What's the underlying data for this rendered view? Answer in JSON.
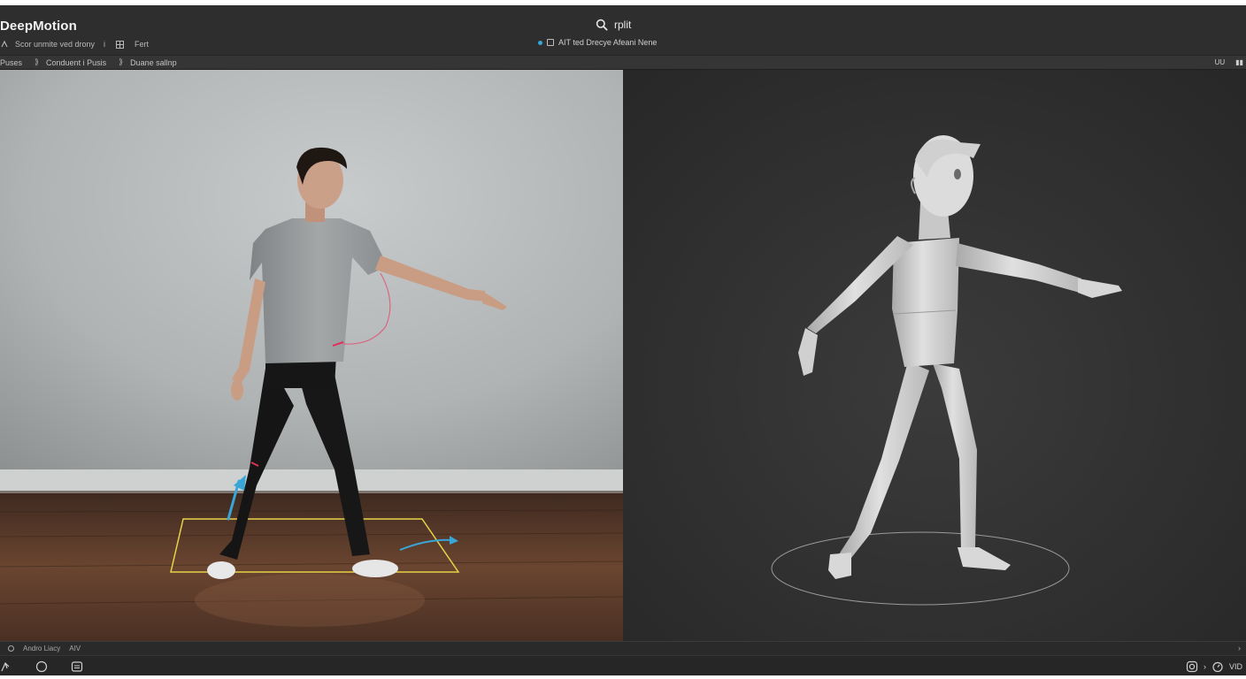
{
  "app": {
    "title": "DeepMotion"
  },
  "search": {
    "text": "rplit",
    "icon": "search-icon"
  },
  "menu": {
    "items": [
      "Scor  unmite ved drony",
      "Fert"
    ],
    "separator": "i"
  },
  "status": {
    "text": "AIT  ted Drecye Afeani Nene"
  },
  "breadcrumb": {
    "items": [
      "Puses",
      "Conduent i Pusis",
      "Duane sallnp"
    ]
  },
  "subbar_right": {
    "labels": [
      "UU",
      "▮▮"
    ]
  },
  "timeline": {
    "label": "Andro Liacy",
    "label2": "AIV",
    "chevron": "›"
  },
  "bottombar": {
    "right_text": "VID",
    "chevron": "›"
  },
  "colors": {
    "app_bg": "#2c2c2c",
    "accent_blue": "#39a6d8",
    "accent_yellow": "#e6d24a",
    "accent_red": "#e0305a"
  }
}
